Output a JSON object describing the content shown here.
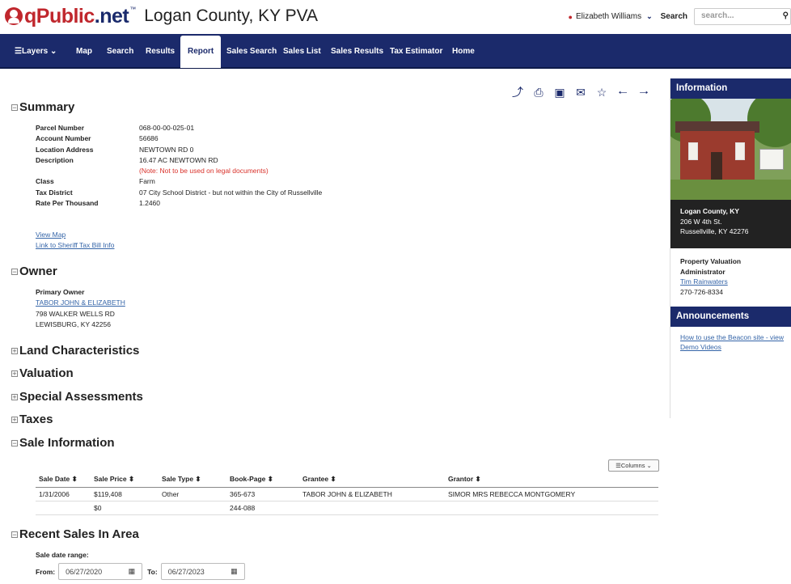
{
  "header": {
    "logo_prefix": "qPublic",
    "logo_suffix": ".net",
    "logo_tm": "™",
    "county_title": "Logan County, KY PVA",
    "user_name": "Elizabeth Williams",
    "search_label": "Search",
    "search_placeholder": "search..."
  },
  "nav": {
    "layers": "☰Layers ⌄",
    "map": "Map",
    "search": "Search",
    "results": "Results",
    "report": "Report",
    "sales_search": "Sales Search",
    "sales_list": "Sales List",
    "sales_results": "Sales Results",
    "tax_estimator": "Tax Estimator",
    "home": "Home"
  },
  "summary": {
    "title": "Summary",
    "rows": [
      {
        "label": "Parcel Number",
        "value": "068-00-00-025-01"
      },
      {
        "label": "Account Number",
        "value": "56686"
      },
      {
        "label": "Location Address",
        "value": "NEWTOWN RD 0"
      },
      {
        "label": "Description",
        "value": "16.47 AC NEWTOWN RD"
      },
      {
        "label": "",
        "value": "(Note: Not to be used on legal documents)"
      },
      {
        "label": "Class",
        "value": "Farm"
      },
      {
        "label": "Tax District",
        "value": "07 City School District - but not within the City of Russellville"
      },
      {
        "label": "Rate Per Thousand",
        "value": "1.2460"
      }
    ],
    "view_map": "View Map",
    "sheriff_link": "Link to Sheriff Tax Bill Info"
  },
  "owner": {
    "title": "Owner",
    "label": "Primary Owner",
    "name": "TABOR JOHN & ELIZABETH",
    "address1": "798 WALKER WELLS RD",
    "address2": "LEWISBURG, KY 42256"
  },
  "sections": {
    "land": "Land Characteristics",
    "valuation": "Valuation",
    "special": "Special Assessments",
    "taxes": "Taxes",
    "sale_info": "Sale Information",
    "recent_sales": "Recent Sales In Area"
  },
  "sales": {
    "columns_btn": "☰Columns ⌄",
    "headers": [
      "Sale Date ⬍",
      "Sale Price ⬍",
      "Sale Type ⬍",
      "Book-Page ⬍",
      "Grantee ⬍",
      "Grantor ⬍"
    ],
    "rows": [
      [
        "1/31/2006",
        "$119,408",
        "Other",
        "365-673",
        "TABOR JOHN & ELIZABETH",
        "SIMOR MRS REBECCA MONTGOMERY"
      ],
      [
        "",
        "$0",
        "",
        "244-088",
        "",
        ""
      ]
    ]
  },
  "recent": {
    "range_label": "Sale date range:",
    "from_label": "From:",
    "from_value": "06/27/2020",
    "to_label": "To:",
    "to_value": "06/27/2023"
  },
  "sidebar": {
    "info_title": "Information",
    "county": "Logan County, KY",
    "street": "206 W 4th St.",
    "city": "Russellville, KY 42276",
    "pva_line1": "Property Valuation",
    "pva_line2": "Administrator",
    "pva_name": "Tim Rainwaters",
    "pva_phone": "270-726-8334",
    "ann_title": "Announcements",
    "ann_link": "How to use the Beacon site - view Demo Videos"
  }
}
